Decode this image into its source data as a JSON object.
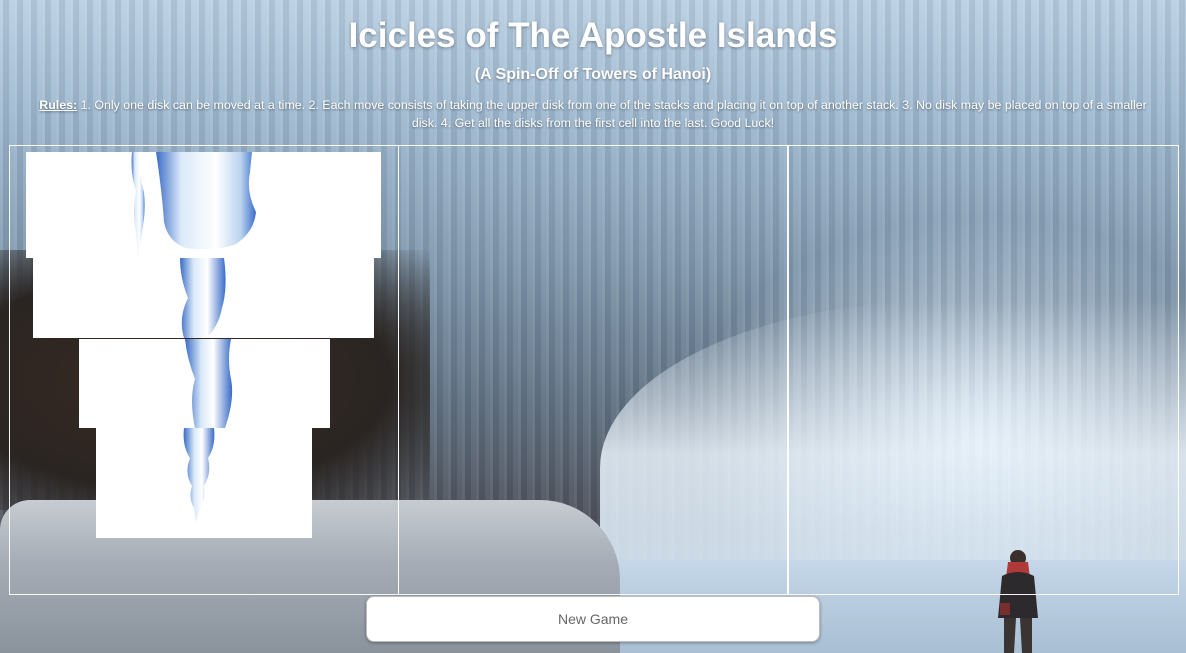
{
  "header": {
    "title": "Icicles of The Apostle Islands",
    "subtitle": "(A Spin-Off of Towers of Hanoi)"
  },
  "rules": {
    "label": "Rules:",
    "text": " 1. Only one disk can be moved at a time. 2. Each move consists of taking the upper disk from one of the stacks and placing it on top of another stack. 3. No disk may be placed on top of a smaller disk. 4. Get all the disks from the first cell into the last. Good Luck!"
  },
  "game": {
    "cells": [
      {
        "id": "cell-1",
        "disks": [
          4,
          3,
          2,
          1
        ]
      },
      {
        "id": "cell-2",
        "disks": []
      },
      {
        "id": "cell-3",
        "disks": []
      }
    ],
    "disk_color": "#ffffff",
    "icicle_color": "#2f64c4"
  },
  "controls": {
    "new_game_label": "New Game"
  }
}
